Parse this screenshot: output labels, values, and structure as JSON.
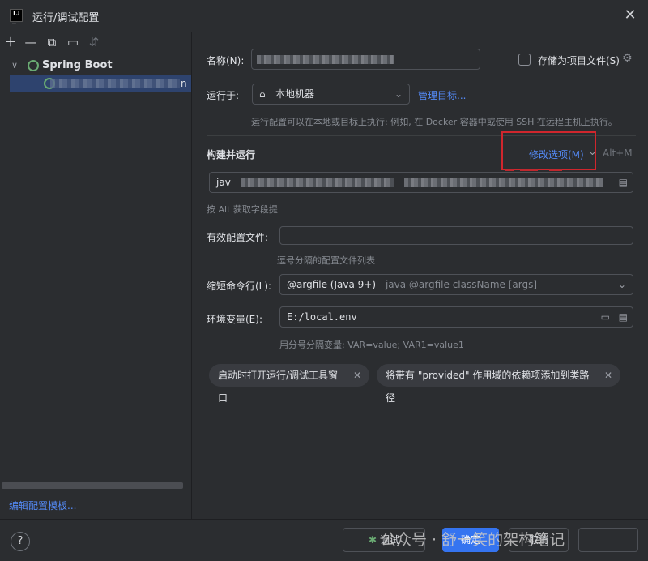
{
  "window": {
    "title": "运行/调试配置",
    "close_icon": "close-icon"
  },
  "left": {
    "toolbar": [
      "add-icon",
      "remove-icon",
      "copy-icon",
      "new-folder-icon",
      "sort-icon"
    ],
    "tree": {
      "group_label": "Spring Boot",
      "child_suffix": "n"
    },
    "edit_templates": "编辑配置模板..."
  },
  "form": {
    "name_label": "名称(N):",
    "store_label": "存储为项目文件(S)",
    "run_on_label": "运行于:",
    "run_on_value": "本地机器",
    "manage_targets": "管理目标...",
    "run_on_hint": "运行配置可以在本地或目标上执行: 例如, 在 Docker 容器中或使用 SSH 在远程主机上执行。",
    "build_run_title": "构建并运行",
    "modify_options": "修改选项(M)",
    "modify_shortcut": "Alt+M",
    "java_prefix": "jav",
    "alt_hint": "按 Alt 获取字段提",
    "active_profiles_label": "有效配置文件:",
    "active_profiles_hint": "逗号分隔的配置文件列表",
    "shorten_label": "缩短命令行(L):",
    "shorten_value": "@argfile (Java 9+)",
    "shorten_desc": " - java @argfile className [args]",
    "env_label": "环境变量(E):",
    "env_value": "E:/local.env",
    "env_hint": "用分号分隔变量: VAR=value; VAR1=value1",
    "chips": [
      "启动时打开运行/调试工具窗口",
      "将带有 \"provided\" 作用域的依赖项添加到类路径"
    ]
  },
  "footer": {
    "help": "?",
    "debug": "调试",
    "ok": "确定",
    "cancel": "取消",
    "watermark": "公众号 · 舒一笑的架构笔记"
  }
}
